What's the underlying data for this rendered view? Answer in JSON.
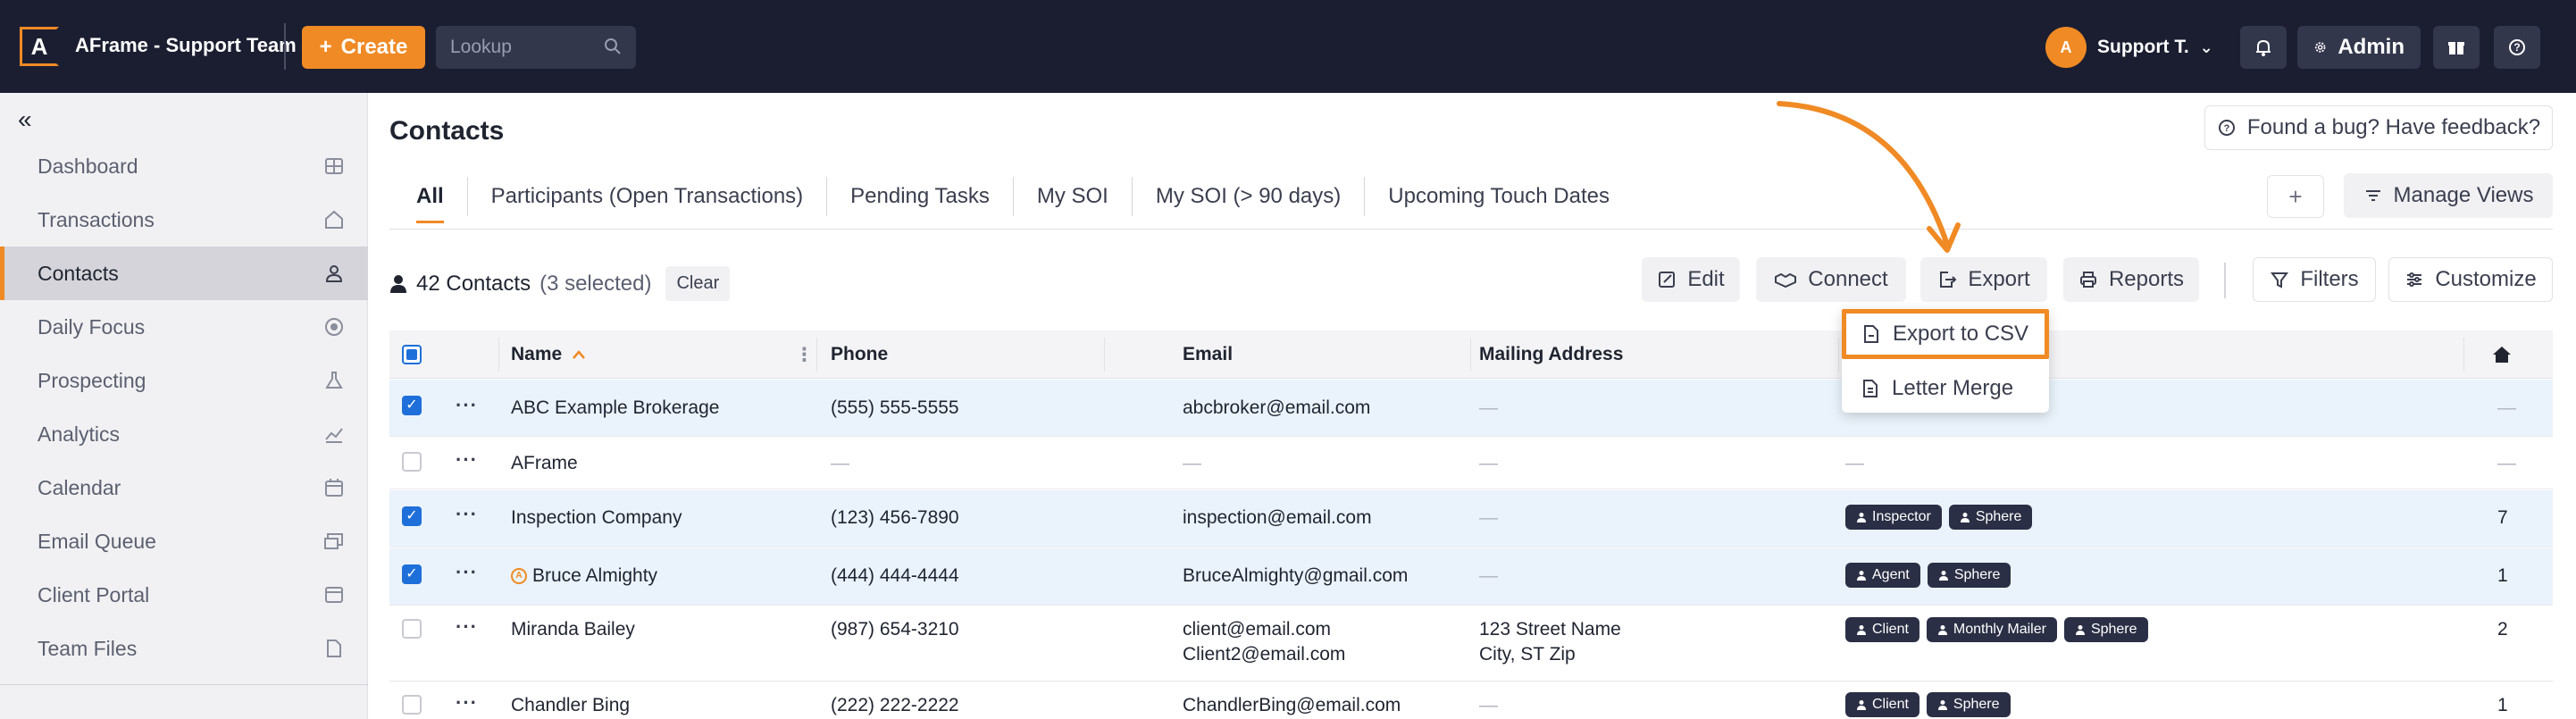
{
  "topbar": {
    "logo_letter": "A",
    "app_title": "AFrame - Support Team",
    "create_label": "Create",
    "lookup_placeholder": "Lookup",
    "user_name": "Support T.",
    "admin_label": "Admin"
  },
  "sidebar": {
    "items": [
      {
        "label": "Dashboard",
        "icon": "grid-icon"
      },
      {
        "label": "Transactions",
        "icon": "home-icon"
      },
      {
        "label": "Contacts",
        "icon": "person-icon",
        "active": true
      },
      {
        "label": "Daily Focus",
        "icon": "target-icon"
      },
      {
        "label": "Prospecting",
        "icon": "flask-icon"
      },
      {
        "label": "Analytics",
        "icon": "chart-icon"
      },
      {
        "label": "Calendar",
        "icon": "calendar-icon"
      },
      {
        "label": "Email Queue",
        "icon": "email-queue-icon"
      },
      {
        "label": "Client Portal",
        "icon": "portal-icon"
      },
      {
        "label": "Team Files",
        "icon": "file-icon"
      }
    ]
  },
  "main": {
    "title": "Contacts",
    "feedback_label": "Found a bug? Have feedback?",
    "tabs": [
      {
        "label": "All",
        "active": true
      },
      {
        "label": "Participants (Open Transactions)"
      },
      {
        "label": "Pending Tasks"
      },
      {
        "label": "My SOI"
      },
      {
        "label": "My SOI (> 90 days)"
      },
      {
        "label": "Upcoming Touch Dates"
      }
    ],
    "add_view_label": "+",
    "manage_views_label": "Manage Views",
    "count_label": "42 Contacts",
    "selected_label": "(3 selected)",
    "clear_label": "Clear",
    "actions": {
      "edit": "Edit",
      "connect": "Connect",
      "export": "Export",
      "reports": "Reports",
      "filters": "Filters",
      "customize": "Customize"
    },
    "export_menu": {
      "csv": "Export to CSV",
      "letter_merge": "Letter Merge"
    },
    "table": {
      "headers": {
        "name": "Name",
        "phone": "Phone",
        "email": "Email",
        "mailing_address": "Mailing Address"
      },
      "dash": "—",
      "rows": [
        {
          "name": "ABC Example Brokerage",
          "phone": "(555) 555-5555",
          "email1": "abcbroker@email.com",
          "email2": "",
          "addr1": "—",
          "addr2": "",
          "tags": [],
          "count": "—",
          "checked": true
        },
        {
          "name": "AFrame",
          "phone": "—",
          "email1": "—",
          "email2": "",
          "addr1": "—",
          "addr2": "",
          "tags": [],
          "tag_dash": "—",
          "count": "—",
          "checked": false
        },
        {
          "name": "Inspection Company",
          "phone": "(123) 456-7890",
          "email1": "inspection@email.com",
          "email2": "",
          "addr1": "—",
          "addr2": "",
          "tags": [
            "Inspector",
            "Sphere"
          ],
          "count": "7",
          "checked": true
        },
        {
          "name": "Bruce Almighty",
          "phone": "(444) 444-4444",
          "email1": "BruceAlmighty@gmail.com",
          "email2": "",
          "addr1": "—",
          "addr2": "",
          "tags": [
            "Agent",
            "Sphere"
          ],
          "count": "1",
          "checked": true,
          "badge": true
        },
        {
          "name": "Miranda Bailey",
          "phone": "(987) 654-3210",
          "email1": "client@email.com",
          "email2": "Client2@email.com",
          "addr1": "123 Street Name",
          "addr2": "City, ST Zip",
          "tags": [
            "Client",
            "Monthly Mailer",
            "Sphere"
          ],
          "count": "2",
          "checked": false
        },
        {
          "name": "Chandler Bing",
          "phone": "(222) 222-2222",
          "email1": "ChandlerBing@email.com",
          "email2": "",
          "addr1": "—",
          "addr2": "",
          "tags": [
            "Client",
            "Sphere"
          ],
          "count": "1",
          "checked": false
        }
      ]
    }
  },
  "colors": {
    "accent": "#f08a24",
    "topbar": "#1b1e31",
    "checkbox_blue": "#1e6fd9",
    "selected_row": "#eaf3fb",
    "tag_bg": "#2b2f45"
  }
}
